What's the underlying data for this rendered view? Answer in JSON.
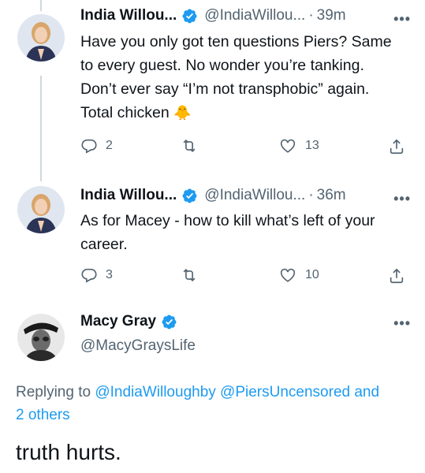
{
  "colors": {
    "accent": "#1d9bf0",
    "secondary_text": "#536471",
    "primary_text": "#0f1419",
    "thread_line": "#cfd9de"
  },
  "tweets": [
    {
      "name": "India Willou...",
      "handle": "@IndiaWillou...",
      "separator": "·",
      "time": "39m",
      "more": "•••",
      "text": "Have you only got ten questions Piers? Same\nto every guest. No wonder you’re tanking.\nDon’t ever say “I’m not transphobic” again.\nTotal chicken",
      "emoji": "🐥",
      "reply_count": "2",
      "retweet_count": "",
      "like_count": "13",
      "verified_icon": "verified-badge-icon"
    },
    {
      "name": "India Willou...",
      "handle": "@IndiaWillou...",
      "separator": "·",
      "time": "36m",
      "more": "•••",
      "text": "As for Macey - how to kill what’s left of your\ncareer.",
      "reply_count": "3",
      "retweet_count": "",
      "like_count": "10",
      "verified_icon": "verified-badge-icon"
    }
  ],
  "main_tweet": {
    "name": "Macy Gray",
    "handle": "@MacyGraysLife",
    "more": "•••",
    "replying_prefix": "Replying to ",
    "replying_user1": "@IndiaWilloughby",
    "replying_user2": "@PiersUncensored",
    "replying_and": " and",
    "replying_others": "2 others",
    "text": "truth hurts."
  }
}
